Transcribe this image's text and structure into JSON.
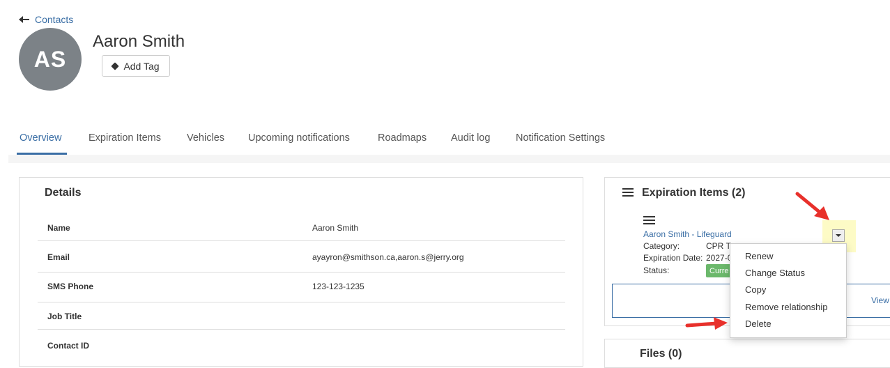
{
  "back_link": "Contacts",
  "contact": {
    "initials": "AS",
    "name": "Aaron Smith",
    "add_tag_label": "Add Tag"
  },
  "tabs": [
    {
      "label": "Overview"
    },
    {
      "label": "Expiration Items"
    },
    {
      "label": "Vehicles"
    },
    {
      "label": "Upcoming notifications"
    },
    {
      "label": "Roadmaps"
    },
    {
      "label": "Audit log"
    },
    {
      "label": "Notification Settings"
    }
  ],
  "details": {
    "title": "Details",
    "rows": [
      {
        "label": "Name",
        "value": "Aaron Smith"
      },
      {
        "label": "Email",
        "value": "ayayron@smithson.ca,aaron.s@jerry.org"
      },
      {
        "label": "SMS Phone",
        "value": "123-123-1235"
      },
      {
        "label": "Job Title",
        "value": ""
      },
      {
        "label": "Contact ID",
        "value": ""
      }
    ]
  },
  "expiration_items": {
    "title": "Expiration Items (2)",
    "item": {
      "link": "Aaron Smith - Lifeguard",
      "category_label": "Category:",
      "category_value": "CPR Tr",
      "expiration_label": "Expiration Date:",
      "expiration_value": "2027-0",
      "status_label": "Status:",
      "status_value": "Curre"
    },
    "view_label": "View"
  },
  "dropdown_menu": {
    "items": [
      "Renew",
      "Change Status",
      "Copy",
      "Remove relationship",
      "Delete"
    ]
  },
  "files": {
    "title": "Files (0)"
  },
  "colors": {
    "accent": "#3a6ea5",
    "avatar": "#7c8287",
    "status_green": "#6bb86b",
    "annotation_red": "#e8302b",
    "highlight_yellow": "#fdfbc6"
  }
}
